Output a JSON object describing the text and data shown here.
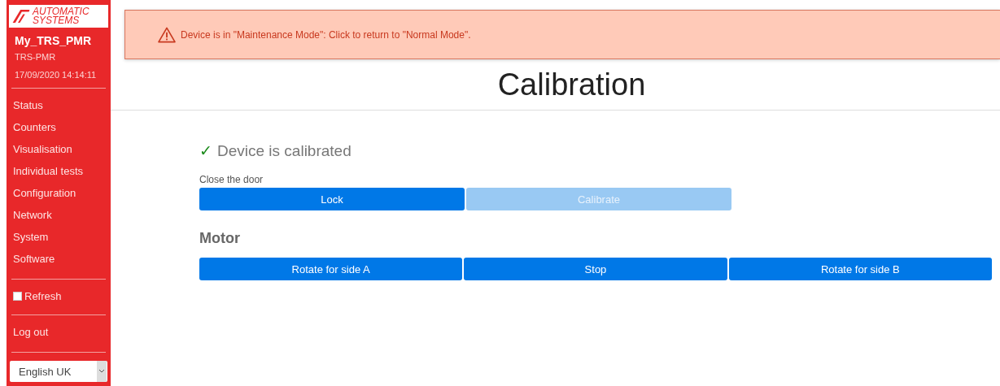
{
  "sidebar": {
    "logo": {
      "line1": "AUTOMATIC",
      "line2": "SYSTEMS"
    },
    "device_name": "My_TRS_PMR",
    "device_model": "TRS-PMR",
    "datetime": "17/09/2020 14:14:11",
    "items": [
      {
        "label": "Status"
      },
      {
        "label": "Counters"
      },
      {
        "label": "Visualisation"
      },
      {
        "label": "Individual tests"
      },
      {
        "label": "Configuration"
      },
      {
        "label": "Network"
      },
      {
        "label": "System"
      },
      {
        "label": "Software"
      }
    ],
    "refresh": {
      "label": "Refresh",
      "checked": false
    },
    "logout": "Log out",
    "language": {
      "value": "English UK"
    }
  },
  "alert": {
    "text": "Device is in \"Maintenance Mode\": Click to return to \"Normal Mode\"."
  },
  "title": "Calibration",
  "status": {
    "calibrated": true,
    "check": "✓",
    "text": "Device is calibrated"
  },
  "door": {
    "label": "Close the door",
    "buttons": [
      {
        "label": "Lock",
        "disabled": false
      },
      {
        "label": "Calibrate",
        "disabled": true
      }
    ]
  },
  "motor": {
    "heading": "Motor",
    "buttons": [
      {
        "label": "Rotate for side A",
        "disabled": false
      },
      {
        "label": "Stop",
        "disabled": false
      },
      {
        "label": "Rotate for side B",
        "disabled": false
      }
    ]
  }
}
